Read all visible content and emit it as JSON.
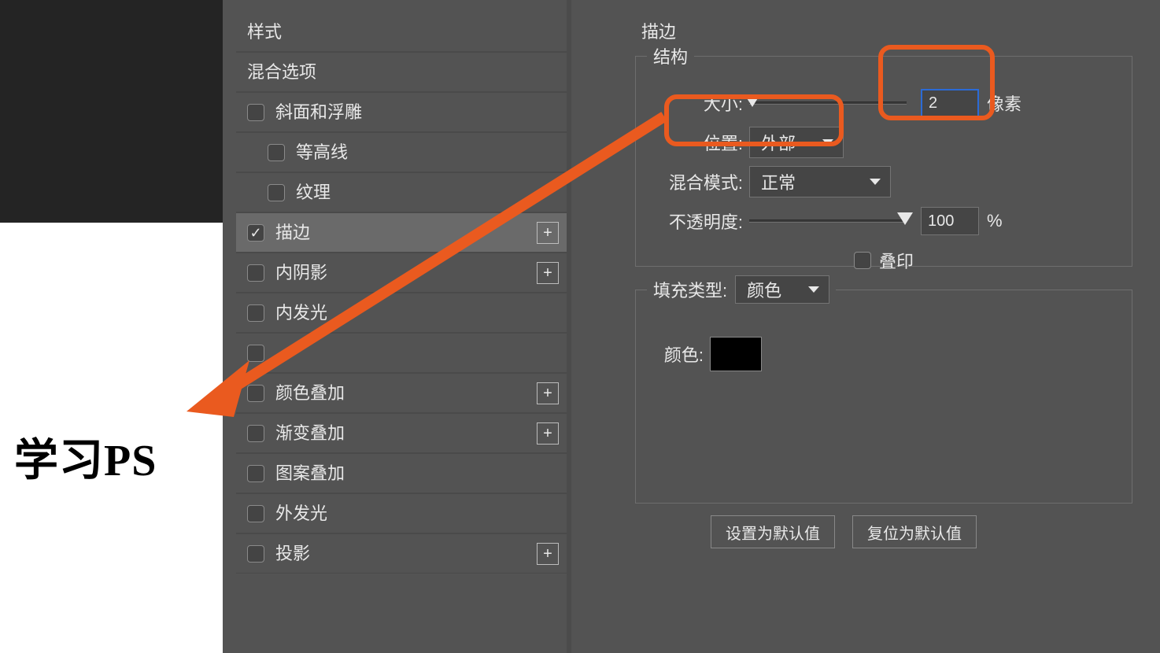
{
  "canvas": {
    "sample_text": "学习PS"
  },
  "styles_panel": {
    "title": "样式",
    "blending_options": "混合选项",
    "effects": {
      "bevel": "斜面和浮雕",
      "contour": "等高线",
      "texture": "纹理",
      "stroke": "描边",
      "inner_shadow": "内阴影",
      "inner_glow": "内发光",
      "satin_hidden": "",
      "color_overlay": "颜色叠加",
      "gradient_overlay": "渐变叠加",
      "pattern_overlay": "图案叠加",
      "outer_glow": "外发光",
      "drop_shadow": "投影"
    }
  },
  "stroke_panel": {
    "title": "描边",
    "structure_legend": "结构",
    "size_label": "大小:",
    "size_value": "2",
    "size_unit": "像素",
    "position_label": "位置:",
    "position_value": "外部",
    "blend_mode_label": "混合模式:",
    "blend_mode_value": "正常",
    "opacity_label": "不透明度:",
    "opacity_value": "100",
    "opacity_unit": "%",
    "overprint_label": "叠印",
    "fill_type_label": "填充类型:",
    "fill_type_value": "颜色",
    "color_label": "颜色:",
    "btn_set_default": "设置为默认值",
    "btn_reset_default": "复位为默认值"
  }
}
